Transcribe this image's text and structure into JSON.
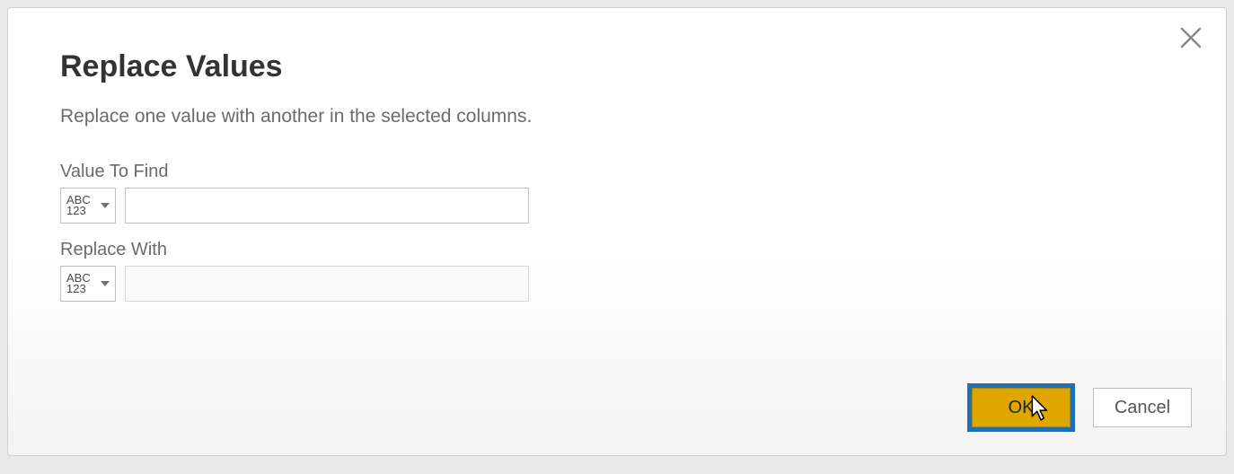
{
  "dialog": {
    "title": "Replace Values",
    "subtitle": "Replace one value with another in the selected columns.",
    "close_aria": "Close"
  },
  "fields": {
    "find": {
      "label": "Value To Find",
      "type_top": "ABC",
      "type_bottom": "123",
      "value": ""
    },
    "replace": {
      "label": "Replace With",
      "type_top": "ABC",
      "type_bottom": "123",
      "value": ""
    }
  },
  "buttons": {
    "ok": "OK",
    "cancel": "Cancel"
  }
}
